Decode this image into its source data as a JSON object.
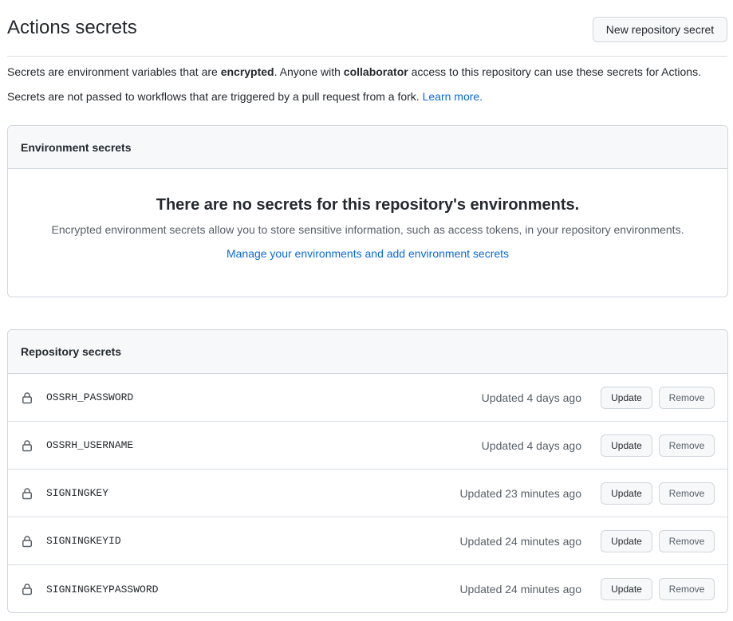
{
  "header": {
    "title": "Actions secrets",
    "new_secret_label": "New repository secret"
  },
  "description": {
    "line1_part1": "Secrets are environment variables that are ",
    "line1_bold1": "encrypted",
    "line1_part2": ". Anyone with ",
    "line1_bold2": "collaborator",
    "line1_part3": " access to this repository can use these secrets for Actions.",
    "line2_text": "Secrets are not passed to workflows that are triggered by a pull request from a fork. ",
    "learn_more": "Learn more."
  },
  "environment_secrets": {
    "title": "Environment secrets",
    "empty_title": "There are no secrets for this repository's environments.",
    "empty_desc": "Encrypted environment secrets allow you to store sensitive information, such as access tokens, in your repository environments.",
    "manage_link": "Manage your environments and add environment secrets"
  },
  "repository_secrets": {
    "title": "Repository secrets",
    "update_label": "Update",
    "remove_label": "Remove",
    "items": [
      {
        "name": "OSSRH_PASSWORD",
        "updated": "Updated 4 days ago"
      },
      {
        "name": "OSSRH_USERNAME",
        "updated": "Updated 4 days ago"
      },
      {
        "name": "SIGNINGKEY",
        "updated": "Updated 23 minutes ago"
      },
      {
        "name": "SIGNINGKEYID",
        "updated": "Updated 24 minutes ago"
      },
      {
        "name": "SIGNINGKEYPASSWORD",
        "updated": "Updated 24 minutes ago"
      }
    ]
  },
  "icons": {
    "row_icon": "lock-icon"
  },
  "colors": {
    "link": "#0969da",
    "border": "#d0d7de",
    "header_bg": "#f6f8fa",
    "muted_text": "#57606a"
  }
}
